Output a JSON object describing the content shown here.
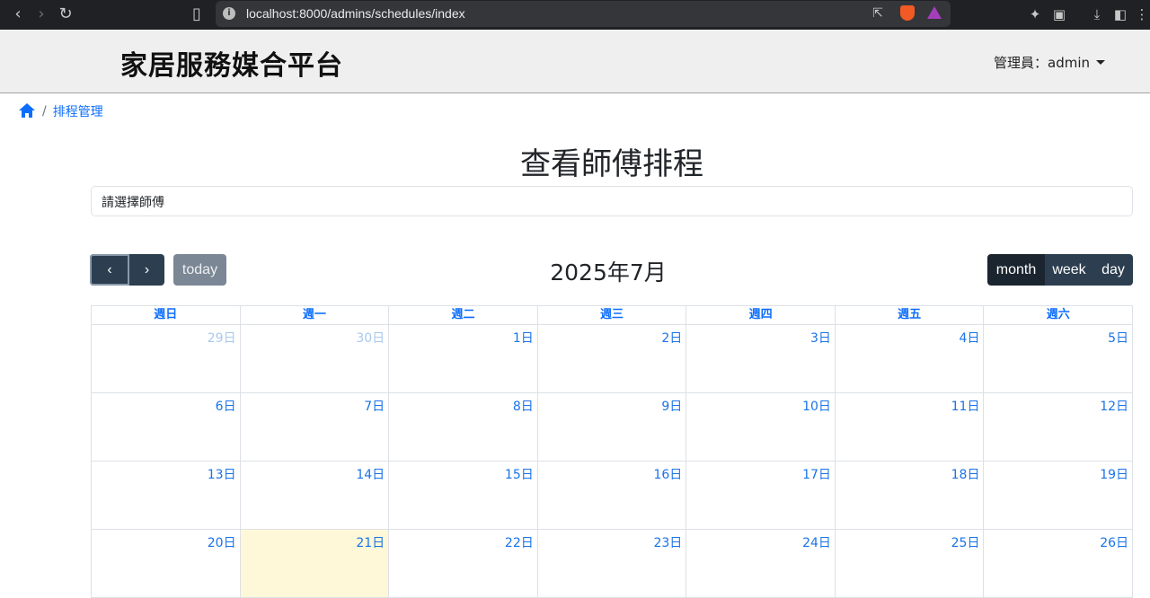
{
  "browser": {
    "url": "localhost:8000/admins/schedules/index"
  },
  "header": {
    "brand": "家居服務媒合平台",
    "admin_label": "管理員：admin"
  },
  "breadcrumb": {
    "separator": "/",
    "current": "排程管理"
  },
  "page_title": "查看師傅排程",
  "select": {
    "value": "請選擇師傅"
  },
  "toolbar": {
    "prev": "‹",
    "next": "›",
    "today": "today",
    "title": "2025年7月",
    "views": [
      "month",
      "week",
      "day"
    ],
    "active_view": "month"
  },
  "calendar": {
    "weekdays": [
      "週日",
      "週一",
      "週二",
      "週三",
      "週四",
      "週五",
      "週六"
    ],
    "weeks": [
      [
        {
          "d": "29日",
          "other": true
        },
        {
          "d": "30日",
          "other": true
        },
        {
          "d": "1日"
        },
        {
          "d": "2日"
        },
        {
          "d": "3日"
        },
        {
          "d": "4日"
        },
        {
          "d": "5日"
        }
      ],
      [
        {
          "d": "6日"
        },
        {
          "d": "7日"
        },
        {
          "d": "8日"
        },
        {
          "d": "9日"
        },
        {
          "d": "10日"
        },
        {
          "d": "11日"
        },
        {
          "d": "12日"
        }
      ],
      [
        {
          "d": "13日"
        },
        {
          "d": "14日"
        },
        {
          "d": "15日"
        },
        {
          "d": "16日"
        },
        {
          "d": "17日"
        },
        {
          "d": "18日"
        },
        {
          "d": "19日"
        }
      ],
      [
        {
          "d": "20日"
        },
        {
          "d": "21日",
          "today": true
        },
        {
          "d": "22日"
        },
        {
          "d": "23日"
        },
        {
          "d": "24日"
        },
        {
          "d": "25日"
        },
        {
          "d": "26日"
        }
      ]
    ],
    "today_color": "#fff8d8",
    "link_color": "#1a73e8"
  }
}
